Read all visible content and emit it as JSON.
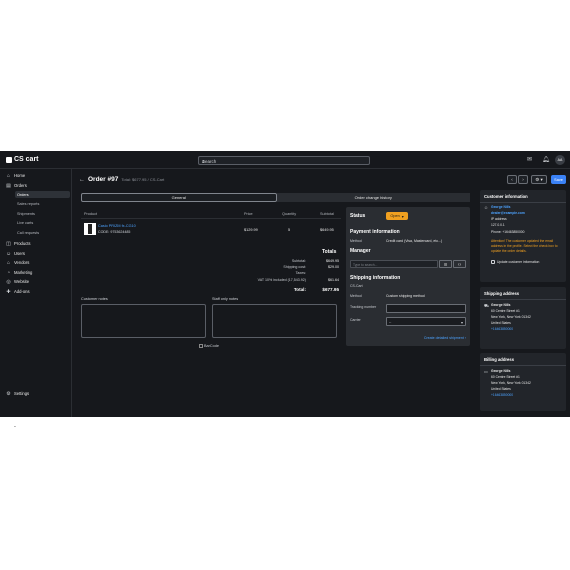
{
  "app": {
    "logo": "CS cart"
  },
  "search": {
    "placeholder": "Search"
  },
  "topbar": {
    "avatar": "AA"
  },
  "sidebar": {
    "items": [
      {
        "label": "Home",
        "icon": "home-icon"
      },
      {
        "label": "Orders",
        "icon": "orders-icon"
      },
      {
        "label": "Products",
        "icon": "products-icon"
      },
      {
        "label": "Users",
        "icon": "users-icon"
      },
      {
        "label": "Vendors",
        "icon": "vendors-icon"
      },
      {
        "label": "Marketing",
        "icon": "marketing-icon"
      },
      {
        "label": "Website",
        "icon": "website-icon"
      },
      {
        "label": "Add-ons",
        "icon": "addons-icon"
      },
      {
        "label": "Settings",
        "icon": "gear-icon"
      }
    ],
    "orders_sub": [
      "Orders",
      "Sales reports",
      "Shipments",
      "Live carts",
      "Call requests"
    ]
  },
  "order": {
    "title": "Order #97",
    "subtitle": "Total: $677.95 / CS-Cart"
  },
  "tabs": [
    "General",
    "Order change history"
  ],
  "header_buttons": {
    "prev": "‹",
    "next": "›",
    "settings": "⚙ ▾",
    "save": "Save"
  },
  "products": {
    "columns": [
      "Product",
      "Price",
      "Quantity",
      "Subtotal"
    ],
    "rows": [
      {
        "name": "Casio PRIZM fx-CG10",
        "code": "CODE: 9753624485",
        "price": "$129.99",
        "quantity": "5",
        "subtotal": "$649.95"
      }
    ]
  },
  "totals": {
    "title": "Totals",
    "lines": [
      {
        "label": "Subtotal:",
        "value": "$649.95"
      },
      {
        "label": "Shipping cost:",
        "value": "$29.00"
      },
      {
        "label": "Taxes:",
        "value": ""
      },
      {
        "label": "VAT 10% included (17,543.92)",
        "value": "$61.64"
      }
    ],
    "total_label": "Total:",
    "total_value": "$677.95"
  },
  "notes": {
    "customer": "Customer notes",
    "staff": "Staff only notes"
  },
  "barcode": "BarCode",
  "status_panel": {
    "status_title": "Status",
    "status_value": "Open",
    "payment_title": "Payment information",
    "method_label": "Method",
    "method_value": "Credit card (Visa, Mastercard, etc...)",
    "manager_title": "Manager",
    "manager_placeholder": "Type to search...",
    "shipping_title": "Shipping information",
    "shipping_company": "CS-Cart",
    "ship_method_label": "Method",
    "ship_method_value": "Custom shipping method",
    "tracking_label": "Tracking number",
    "carrier_label": "Carrier",
    "carrier_value": "--",
    "create_link": "Create detailed shipment ›"
  },
  "customer": {
    "title": "Customer information",
    "name": "George Nills",
    "email": "dealer@example.com",
    "ip_label": "IP address",
    "ip": "127.0.0.1",
    "phone": "Phone: +16463850000",
    "warning": "Attention! The customer updated the email address in the profile. Select the check box to update the order details.",
    "checkbox": "Update customer information"
  },
  "shipping_address": {
    "title": "Shipping address",
    "name": "George Nills",
    "street": "60 Centre Street #1",
    "city": "New York, New York 01342",
    "country": "United States",
    "phone": "+16463850000"
  },
  "billing_address": {
    "title": "Billing address",
    "name": "George Nills",
    "street": "60 Centre Street #1",
    "city": "New York, New York 01342",
    "country": "United States",
    "phone": "+16463850000"
  },
  "colors": {
    "background": "#16181c",
    "accent": "#3b82f6",
    "status": "#f0a020",
    "link": "#4da3ff"
  }
}
